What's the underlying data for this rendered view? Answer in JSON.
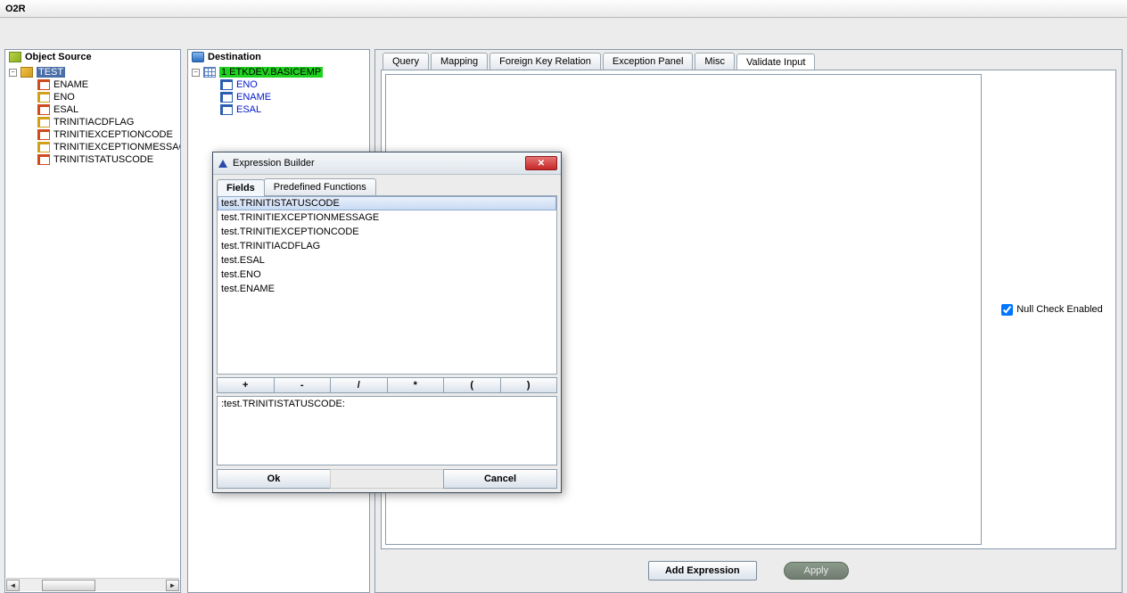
{
  "app": {
    "title": "O2R"
  },
  "source": {
    "header": "Object Source",
    "root": "TEST",
    "children": [
      "ENAME",
      "ENO",
      "ESAL",
      "TRINITIACDFLAG",
      "TRINITIEXCEPTIONCODE",
      "TRINITIEXCEPTIONMESSAGE",
      "TRINITISTATUSCODE"
    ]
  },
  "dest": {
    "header": "Destination",
    "root": "1 ETKDEV.BASICEMP",
    "children": [
      "ENO",
      "ENAME",
      "ESAL"
    ]
  },
  "mainTabs": {
    "items": [
      "Query",
      "Mapping",
      "Foreign Key Relation",
      "Exception Panel",
      "Misc",
      "Validate Input"
    ],
    "activeIndex": 5
  },
  "validate": {
    "nullCheckLabel": "Null Check Enabled",
    "nullCheckChecked": true,
    "addExpressionLabel": "Add Expression",
    "applyLabel": "Apply"
  },
  "dialog": {
    "title": "Expression Builder",
    "tabs": [
      "Fields",
      "Predefined Functions"
    ],
    "activeTab": 0,
    "fields": [
      "test.TRINITISTATUSCODE",
      "test.TRINITIEXCEPTIONMESSAGE",
      "test.TRINITIEXCEPTIONCODE",
      "test.TRINITIACDFLAG",
      "test.ESAL",
      "test.ENO",
      "test.ENAME"
    ],
    "selectedField": 0,
    "operators": [
      "+",
      "-",
      "/",
      "*",
      "(",
      ")"
    ],
    "expression": ":test.TRINITISTATUSCODE:",
    "okLabel": "Ok",
    "cancelLabel": "Cancel"
  }
}
